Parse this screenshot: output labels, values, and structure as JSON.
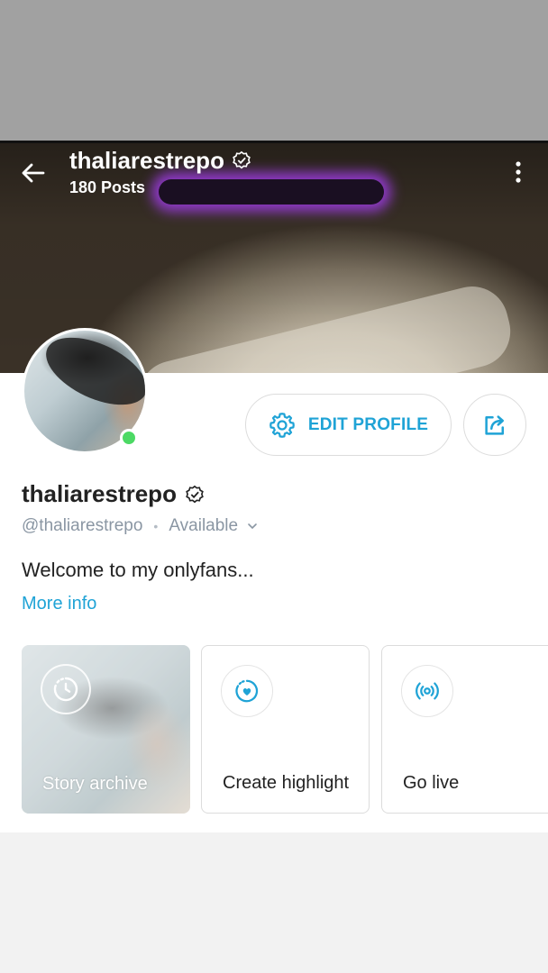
{
  "header": {
    "username": "thaliarestrepo",
    "posts_count": "180 Posts"
  },
  "profile": {
    "display_name": "thaliarestrepo",
    "handle": "@thaliarestrepo",
    "separator": "•",
    "status": "Available",
    "bio": "Welcome to my onlyfans...",
    "more_info": "More info",
    "online": true
  },
  "actions": {
    "edit_profile": "EDIT PROFILE"
  },
  "cards": [
    {
      "label": "Story archive",
      "icon": "clock-icon"
    },
    {
      "label": "Create highlight",
      "icon": "heart-icon"
    },
    {
      "label": "Go live",
      "icon": "broadcast-icon"
    }
  ],
  "colors": {
    "accent": "#1fa3d6",
    "online": "#4cd964",
    "muted_text": "#8a96a3"
  }
}
